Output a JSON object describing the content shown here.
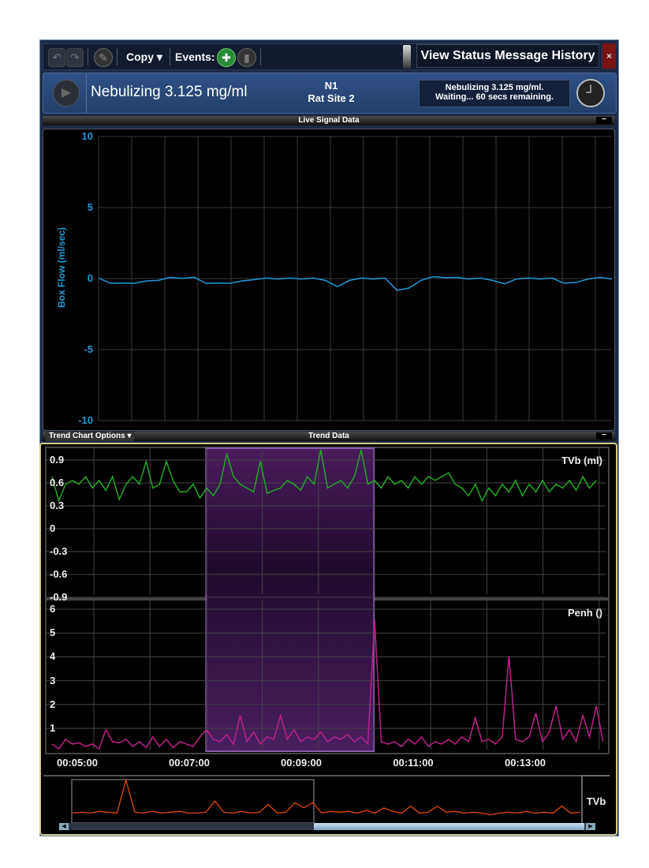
{
  "toolbar": {
    "copy_label": "Copy ▾",
    "events_label": "Events:",
    "view_history_label": "View Status Message History",
    "close_label": "×"
  },
  "header": {
    "title": "Nebulizing 3.125 mg/ml",
    "subject": "N1",
    "site": "Rat Site 2",
    "status_line1": "Nebulizing 3.125 mg/ml.",
    "status_line2": "Waiting... 60 secs remaining."
  },
  "live": {
    "section_title": "Live Signal Data",
    "minimize_label": "−"
  },
  "trend": {
    "options_label": "Trend Chart Options ▾",
    "section_title": "Trend Data",
    "minimize_label": "−",
    "overview_label": "TVb"
  },
  "colors": {
    "flow": "#1e9ad8",
    "tvb": "#22aa22",
    "penh": "#c0208a",
    "overview": "#e0480a",
    "highlight": "#6a2c8a"
  },
  "chart_data": [
    {
      "type": "line",
      "title": "Live Signal Data",
      "ylabel": "Box Flow (ml/sec)",
      "ylim": [
        -10,
        10
      ],
      "yticks": [
        "10",
        "5",
        "0",
        "-5",
        "-10"
      ],
      "values": [
        0,
        -0.3,
        -0.35,
        -0.3,
        -0.2,
        -0.1,
        0.05,
        0.05,
        0.05,
        -0.3,
        -0.35,
        -0.3,
        -0.2,
        -0.05,
        0,
        0,
        0,
        0,
        0,
        -0.1,
        -0.6,
        -0.1,
        0,
        0,
        0,
        -0.8,
        -0.7,
        -0.1,
        0.1,
        0.1,
        0.05,
        0,
        0,
        -0.1,
        -0.4,
        0,
        0,
        0,
        0,
        -0.3,
        -0.3,
        0,
        0.05,
        0
      ]
    },
    {
      "type": "line",
      "name": "TVb (ml)",
      "label": "TVb (ml)",
      "ylim": [
        -0.9,
        0.9
      ],
      "yticks": [
        "0.9",
        "0.6",
        "0.3",
        "0",
        "-0.3",
        "-0.6",
        "-0.9"
      ],
      "x_start_min": 4.55,
      "x_step_min": 0.12,
      "values": [
        0.6,
        0.28,
        0.5,
        0.55,
        0.5,
        0.6,
        0.45,
        0.55,
        0.42,
        0.6,
        0.3,
        0.5,
        0.6,
        0.5,
        0.8,
        0.45,
        0.5,
        0.8,
        0.55,
        0.4,
        0.4,
        0.5,
        0.32,
        0.45,
        0.35,
        0.5,
        0.9,
        0.6,
        0.5,
        0.45,
        0.4,
        0.8,
        0.38,
        0.42,
        0.45,
        0.55,
        0.5,
        0.42,
        0.6,
        0.5,
        0.95,
        0.45,
        0.5,
        0.55,
        0.45,
        0.6,
        0.95,
        0.5,
        0.55,
        0.45,
        0.6,
        0.5,
        0.55,
        0.45,
        0.6,
        0.5,
        0.6,
        0.55,
        0.6,
        0.65,
        0.5,
        0.45,
        0.35,
        0.5,
        0.28,
        0.45,
        0.35,
        0.5,
        0.4,
        0.55,
        0.35,
        0.5,
        0.4,
        0.55,
        0.4,
        0.5,
        0.45,
        0.55,
        0.42,
        0.6,
        0.45,
        0.55
      ]
    },
    {
      "type": "line",
      "name": "Penh ()",
      "label": "Penh ()",
      "ylim": [
        0,
        6.5
      ],
      "yticks": [
        "6",
        "5",
        "4",
        "3",
        "2",
        "1"
      ],
      "x_start_min": 4.55,
      "x_step_min": 0.12,
      "values": [
        0.3,
        0.1,
        0.5,
        0.3,
        0.35,
        0.2,
        0.3,
        0.1,
        0.9,
        0.4,
        0.35,
        0.5,
        0.2,
        0.4,
        0.15,
        0.6,
        0.2,
        0.5,
        0.15,
        0.4,
        0.3,
        0.2,
        0.6,
        0.9,
        0.5,
        0.4,
        0.7,
        0.3,
        1.5,
        0.4,
        0.8,
        0.3,
        0.6,
        0.5,
        1.5,
        0.5,
        0.9,
        0.4,
        0.6,
        0.5,
        0.8,
        0.4,
        0.6,
        0.5,
        0.7,
        0.4,
        0.6,
        0.3,
        5.5,
        0.4,
        0.3,
        0.4,
        0.2,
        0.5,
        0.3,
        0.6,
        0.2,
        0.4,
        0.3,
        0.5,
        0.3,
        0.6,
        0.4,
        1.4,
        0.4,
        0.5,
        0.3,
        0.6,
        4,
        0.5,
        0.4,
        0.6,
        1.6,
        0.4,
        0.8,
        1.9,
        0.5,
        0.9,
        0.4,
        1.5,
        0.6,
        1.9,
        0.4
      ]
    },
    {
      "type": "line",
      "name": "TVb overview",
      "values": [
        0.3,
        0.35,
        0.3,
        0.4,
        0.35,
        0.3,
        2.2,
        0.35,
        0.3,
        0.4,
        0.3,
        0.35,
        0.4,
        0.3,
        0.3,
        0.35,
        1.0,
        0.35,
        0.3,
        0.4,
        0.3,
        0.35,
        0.8,
        0.3,
        0.35,
        0.9,
        0.6,
        0.9,
        0.3,
        0.4,
        0.35,
        0.4,
        0.3,
        0.45,
        0.3,
        0.6,
        0.4,
        0.3,
        0.7,
        0.3,
        0.35,
        0.7,
        0.35,
        0.4,
        0.3,
        0.35,
        0.3,
        0.2,
        0.3,
        0.35,
        0.3,
        0.4,
        0.3,
        0.35,
        0.3,
        0.7,
        0.3,
        0.35
      ]
    }
  ],
  "time_axis": {
    "labels": [
      "00:05:00",
      "00:07:00",
      "00:09:00",
      "00:11:00",
      "00:13:00"
    ],
    "selection_start_min": 7.3,
    "selection_end_min": 10.3
  }
}
